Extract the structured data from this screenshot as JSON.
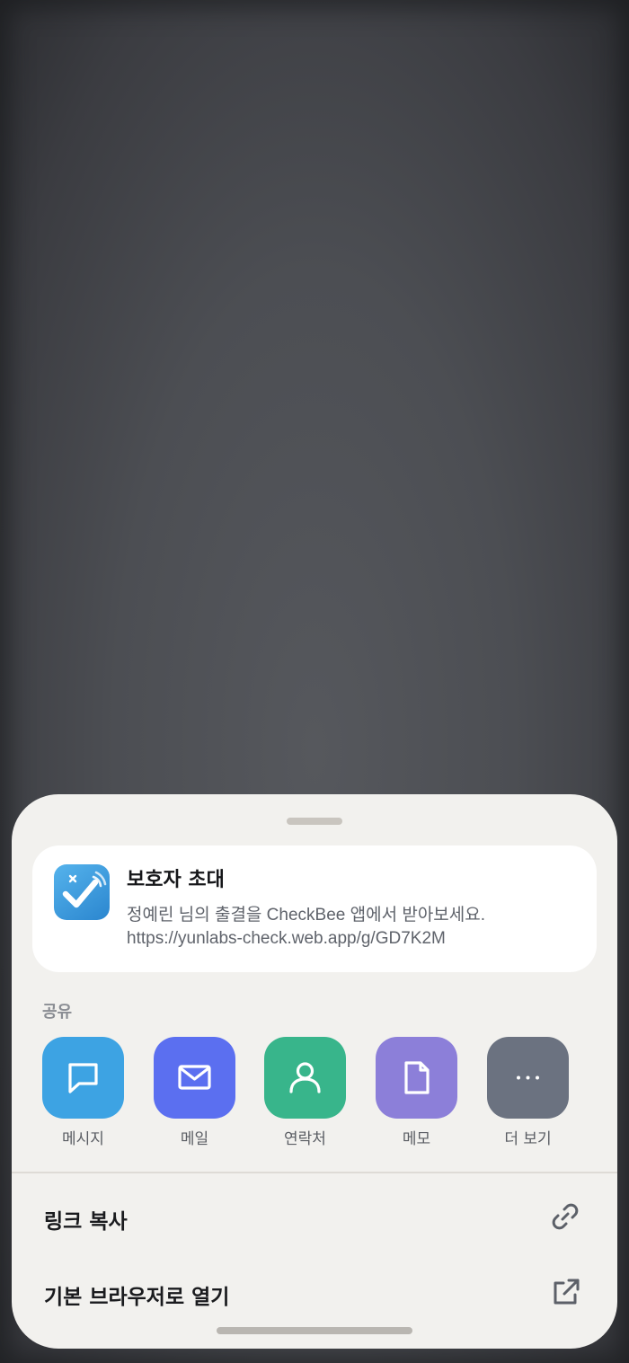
{
  "preview": {
    "app_icon": "checkbee-app-icon",
    "title": "보호자 초대",
    "description": "정예린 님의 출결을 CheckBee 앱에서 받아보세요.",
    "url": "https://yunlabs-check.web.app/g/GD7K2M"
  },
  "share": {
    "section_label": "공유",
    "targets": [
      {
        "label": "메시지",
        "icon": "message-bubble-icon",
        "color": "#3da3e3"
      },
      {
        "label": "메일",
        "icon": "mail-icon",
        "color": "#5b6ff0"
      },
      {
        "label": "연락처",
        "icon": "contact-person-icon",
        "color": "#38b58b"
      },
      {
        "label": "메모",
        "icon": "note-document-icon",
        "color": "#8c7fd9"
      },
      {
        "label": "더 보기",
        "icon": "more-dots-icon",
        "color": "#6b7280"
      }
    ]
  },
  "actions": [
    {
      "label": "링크 복사",
      "icon": "link-icon"
    },
    {
      "label": "기본 브라우저로 열기",
      "icon": "open-external-icon"
    }
  ],
  "colors": {
    "sheet_background": "#f2f1ee",
    "card_background": "#ffffff",
    "title_text": "#16171a",
    "secondary_text": "#5f636b",
    "icon_gray": "#5c6068"
  }
}
